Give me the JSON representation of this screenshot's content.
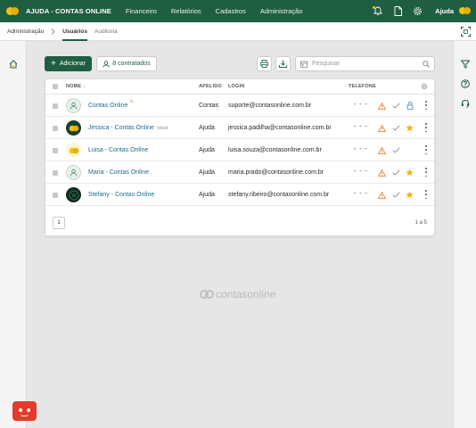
{
  "app": {
    "title": "AJUDA - CONTAS ONLINE",
    "user": "Ajuda"
  },
  "nav": [
    "Financeiro",
    "Relatórios",
    "Cadastros",
    "Administração"
  ],
  "breadcrumb": {
    "root": "Administração",
    "tabs": [
      "Usuários",
      "Auditoria"
    ],
    "active": "Usuários"
  },
  "toolbar": {
    "add_label": "Adicionar",
    "contracted_label": "8 contratados",
    "search_placeholder": "Pesquisar"
  },
  "table": {
    "columns": {
      "name": "NOME",
      "alias": "APELIDO",
      "login": "LOGIN",
      "phone": "TELEFONE"
    },
    "rows": [
      {
        "name": "Contas Online",
        "alias": "Contas",
        "login": "suporte@contasonline.com.br",
        "phone": "- - -",
        "avatar": "user-outline",
        "star": false
      },
      {
        "name": "Jessica - Contas Online",
        "you": "Você",
        "alias": "Ajuda",
        "login": "jessica.padilha@contasonline.com.br",
        "phone": "- - -",
        "avatar": "logo-dark",
        "star": true
      },
      {
        "name": "Luisa - Contas Online",
        "alias": "Ajuda",
        "login": "luisa.souza@contasonline.com.br",
        "phone": "- - -",
        "avatar": "logo-yellow",
        "star": false
      },
      {
        "name": "Maria - Contas Online",
        "alias": "Ajuda",
        "login": "maria.prado@contasonline.com.br",
        "phone": "- - -",
        "avatar": "user-outline",
        "star": true
      },
      {
        "name": "Stefany - Contas Online",
        "alias": "Ajuda",
        "login": "stefany.ribeiro@contasonline.com.br",
        "phone": "- - -",
        "avatar": "dark",
        "star": true
      }
    ],
    "page": "1",
    "count": "1 a 5"
  },
  "footer_brand": "contasonline",
  "colors": {
    "primary": "#1f5e41",
    "accent": "#f2c40f",
    "link": "#1e6a8c",
    "warning": "#e08a1e"
  }
}
